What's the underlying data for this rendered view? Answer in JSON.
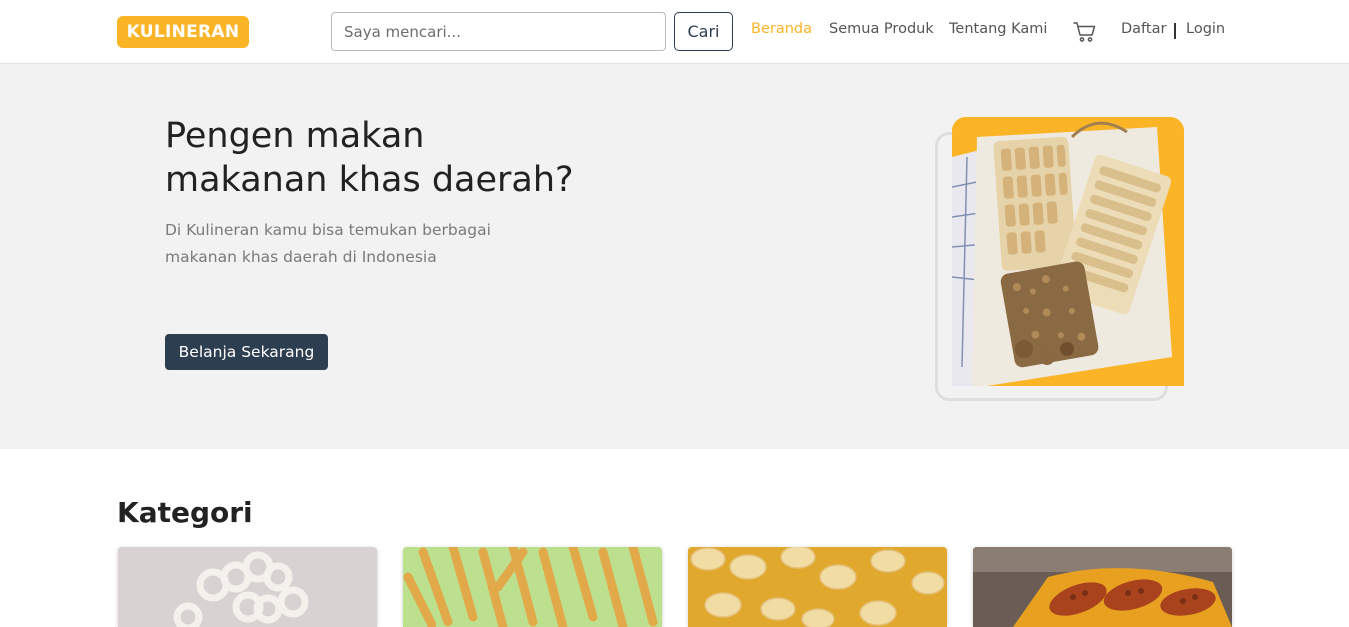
{
  "navbar": {
    "logo": "KULINERAN",
    "search_placeholder": "Saya mencari...",
    "search_button": "Cari",
    "links": [
      {
        "label": "Beranda",
        "active": true
      },
      {
        "label": "Semua Produk",
        "active": false
      },
      {
        "label": "Tentang Kami",
        "active": false
      }
    ],
    "cart_icon": "shopping-cart-icon",
    "register": "Daftar",
    "login": "Login"
  },
  "hero": {
    "title_line1": "Pengen makan",
    "title_line2": "makanan khas daerah?",
    "desc_line1": "Di Kulineran kamu bisa temukan berbagai",
    "desc_line2": "makanan khas daerah di Indonesia",
    "cta": "Belanja Sekarang"
  },
  "category": {
    "title": "Kategori"
  },
  "colors": {
    "brand": "#fbb426",
    "dark": "#2c3e50",
    "hero_bg": "#f2f2f2"
  }
}
